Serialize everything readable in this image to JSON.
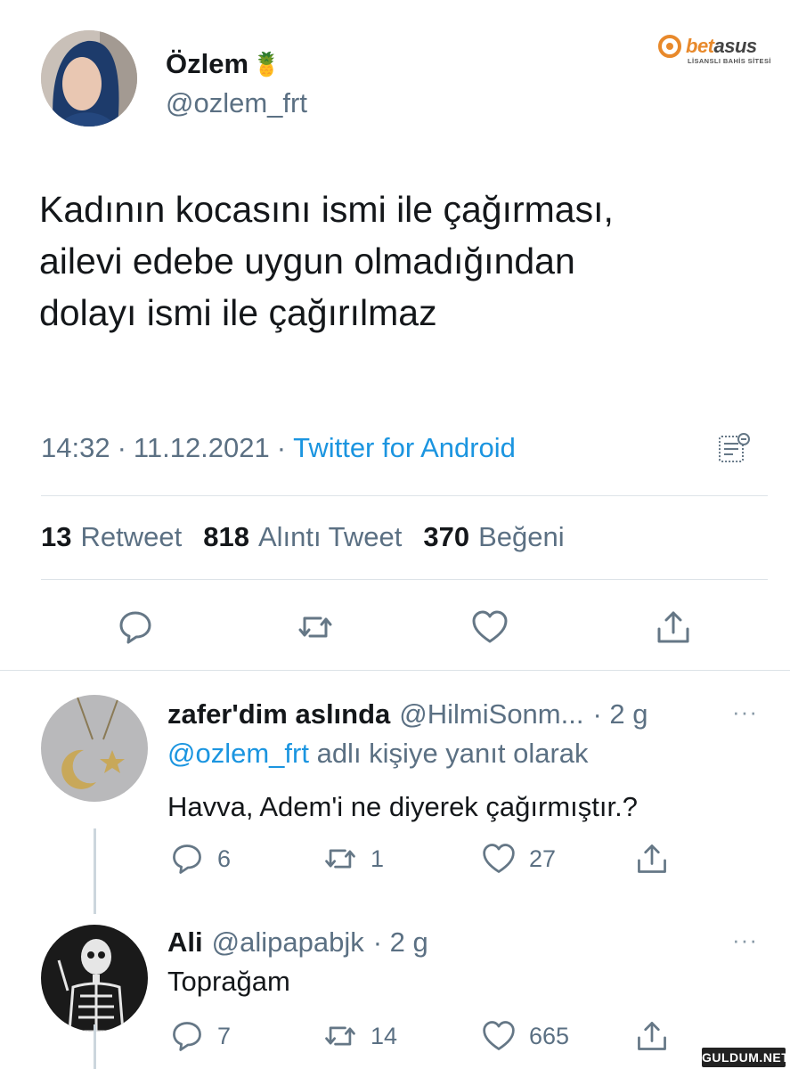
{
  "tweet": {
    "author_name": "Özlem",
    "author_emoji": "🍍",
    "author_handle": "@ozlem_frt",
    "text_lines": [
      "Kadının kocasını ismi ile çağırması,",
      "ailevi edebe uygun olmadığından",
      "dolayı ismi ile çağırılmaz"
    ],
    "time": "14:32",
    "date": "11.12.2021",
    "source": "Twitter for Android",
    "sep": "·"
  },
  "stats": {
    "retweets": "13",
    "retweets_label": "Retweet",
    "quotes": "818",
    "quotes_label": "Alıntı Tweet",
    "likes": "370",
    "likes_label": "Beğeni"
  },
  "brand": {
    "word_a": "bet",
    "word_b": "asus",
    "subtitle": "LİSANSLI BAHİS SİTESİ"
  },
  "replies": [
    {
      "name": "zafer'dim aslında",
      "handle": "@HilmiSonm...",
      "time": "· 2 g",
      "reply_to_handle": "@ozlem_frt",
      "reply_to_suffix": "adlı kişiye yanıt olarak",
      "text": "Havva, Adem'i ne diyerek çağırmıştır.?",
      "reply_count": "6",
      "retweet_count": "1",
      "like_count": "27"
    },
    {
      "name": "Ali",
      "handle": "@alipapabjk",
      "time": "· 2 g",
      "text": "Toprağam",
      "reply_count": "7",
      "retweet_count": "14",
      "like_count": "665"
    }
  ],
  "more_menu": "···",
  "watermark": "GULDUM.NET",
  "colors": {
    "text": "#14171a",
    "secondary": "#5b7083",
    "link": "#1b95e0",
    "divider": "#dde3e8",
    "brand_accent": "#e8892b"
  },
  "icons": [
    "reply-icon",
    "retweet-icon",
    "like-icon",
    "share-icon",
    "analytics-icon",
    "more-icon"
  ]
}
